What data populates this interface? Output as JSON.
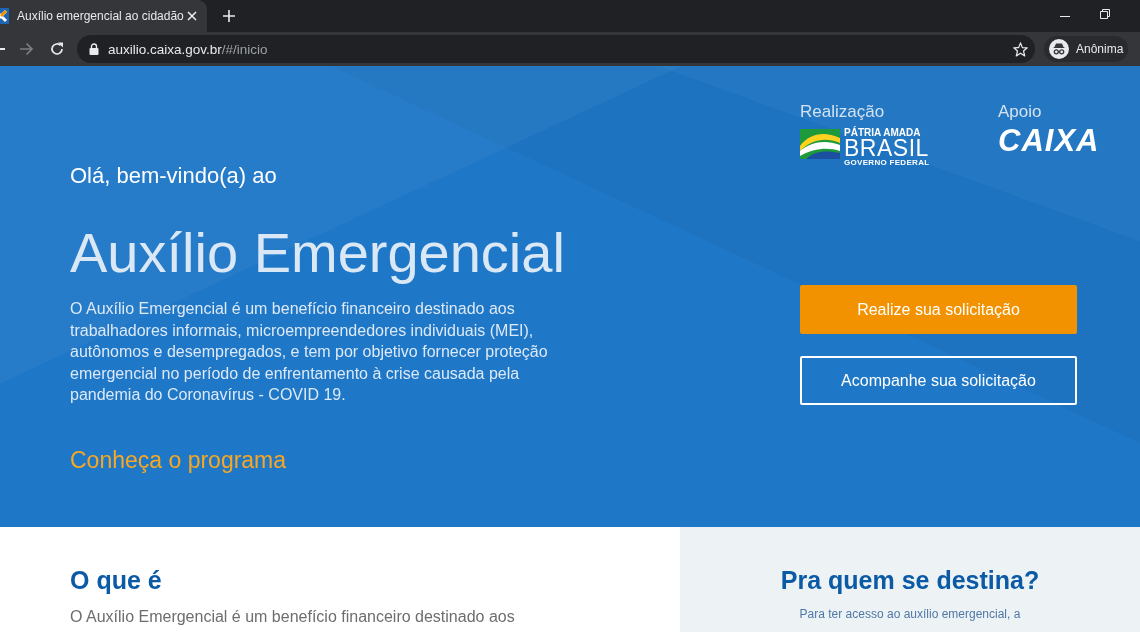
{
  "browser": {
    "tab": {
      "title": "Auxílio emergencial ao cidadão",
      "selected": true
    },
    "navigation": [
      {
        "kind": "back",
        "disabled": false
      },
      {
        "kind": "forward",
        "disabled": true
      },
      {
        "kind": "reload",
        "disabled": false
      }
    ],
    "address_bar": {
      "host": "auxilio.caixa.gov.br",
      "path": "/#/inicio"
    },
    "profile": {
      "label": "Anônima"
    }
  },
  "hero": {
    "greeting": "Olá, bem-vindo(a) ao",
    "title": "Auxílio Emergencial",
    "description": "O Auxílio Emergencial é um benefício financeiro destinado aos trabalhadores informais, microempreendedores individuais (MEI), autônomos e desempregados, e tem por objetivo fornecer proteção emergencial no período de enfrentamento à crise causada pela pandemia do Coronavírus - COVID 19.",
    "link": "Conheça o programa",
    "sponsors": [
      {
        "kind": "government",
        "caption": "Realização",
        "logo": [
          "PÁTRIA AMADA",
          "BRASIL",
          "GOVERNO FEDERAL"
        ]
      },
      {
        "kind": "bank",
        "caption": "Apoio",
        "logo": [
          "CAIXA"
        ]
      }
    ],
    "buttons": [
      {
        "kind": "primary",
        "label": "Realize sua solicitação"
      },
      {
        "kind": "outline",
        "label": "Acompanhe sua solicitação"
      }
    ]
  },
  "sections": [
    {
      "kind": "main",
      "title": "O que é",
      "text": "O Auxílio Emergencial é um benefício financeiro destinado aos"
    },
    {
      "kind": "aside",
      "title": "Pra quem se destina?",
      "text": "Para ter acesso ao auxílio emergencial, a"
    }
  ]
}
